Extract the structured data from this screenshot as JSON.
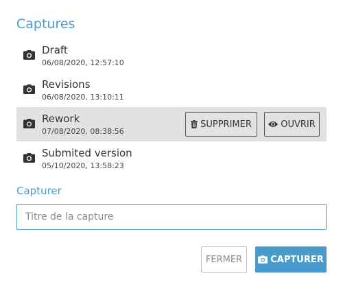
{
  "panel": {
    "title": "Captures"
  },
  "captures": [
    {
      "name": "Draft",
      "date": "06/08/2020, 12:57:10",
      "icon": "camera-icon",
      "active": false
    },
    {
      "name": "Revisions",
      "date": "06/08/2020, 13:10:11",
      "icon": "camera-icon",
      "active": false
    },
    {
      "name": "Rework",
      "date": "07/08/2020, 08:38:56",
      "icon": "camera-icon",
      "active": true
    },
    {
      "name": "Submited version",
      "date": "05/10/2020, 13:58:23",
      "icon": "camera-icon",
      "active": false
    }
  ],
  "row_actions": {
    "delete_label": "SUPPRIMER",
    "delete_icon": "trash-icon",
    "open_label": "OUVRIR",
    "open_icon": "eye-icon"
  },
  "capture_form": {
    "label": "Capturer",
    "placeholder": "Titre de la capture",
    "value": "",
    "close_label": "FERMER",
    "capture_label": "CAPTURER",
    "capture_icon": "camera-icon"
  },
  "colors": {
    "accent": "#4a9bcd",
    "active_row": "#e2e2e2",
    "text": "#333333"
  }
}
